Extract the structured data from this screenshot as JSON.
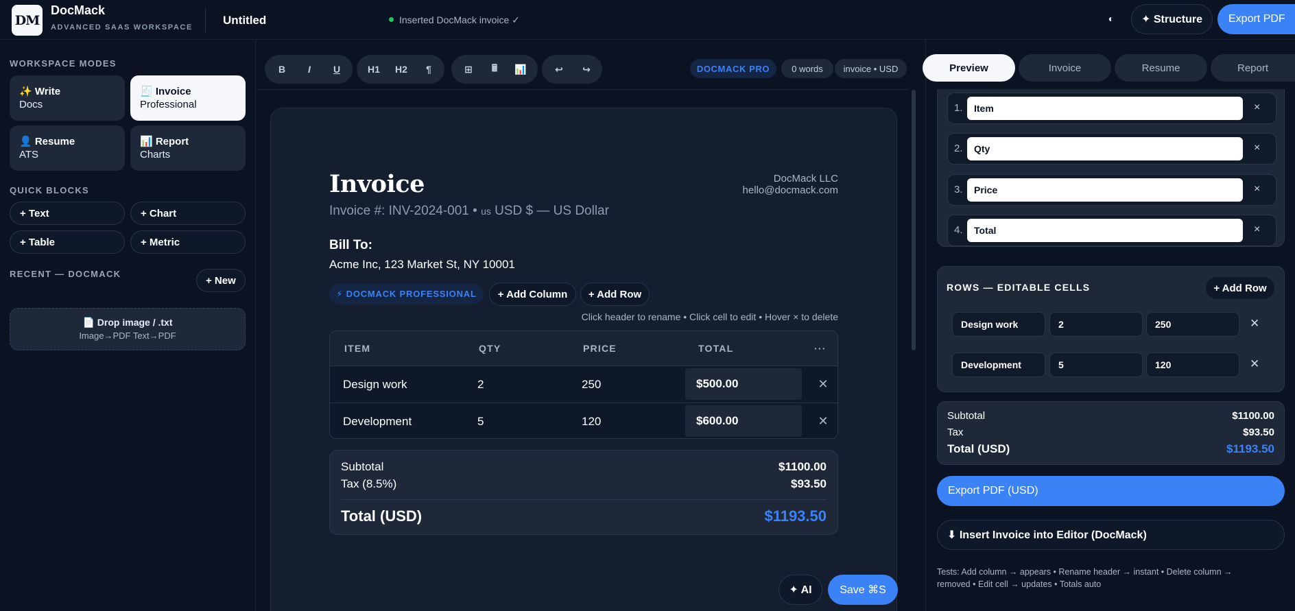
{
  "header": {
    "logo": "DM",
    "app_name": "DocMack",
    "app_subtitle": "ADVANCED SAAS WORKSPACE",
    "doc_title": "Untitled",
    "status": "Inserted DocMack invoice ✓",
    "theme_icon": "◐",
    "structure_label": "✦ Structure",
    "export_label": "Export PDF"
  },
  "sidebar": {
    "modes_label": "WORKSPACE MODES",
    "modes": [
      {
        "title": "✨ Write",
        "sub": "Docs",
        "active": false
      },
      {
        "title": "🧾 Invoice",
        "sub": "Professional",
        "active": true
      },
      {
        "title": "👤 Resume",
        "sub": "ATS",
        "active": false
      },
      {
        "title": "📊 Report",
        "sub": "Charts",
        "active": false
      }
    ],
    "blocks_label": "QUICK BLOCKS",
    "blocks": [
      "+ Text",
      "+ Chart",
      "+ Table",
      "+ Metric"
    ],
    "recent_label": "RECENT — DOCMACK",
    "new_label": "+ New",
    "drop_title": "📄 Drop image / .txt",
    "drop_sub": "Image→PDF Text→PDF"
  },
  "toolbar": {
    "format": [
      "B",
      "I",
      "U"
    ],
    "headings": [
      "H1",
      "H2",
      "¶"
    ],
    "inserts": [
      "⊞",
      "🖩",
      "📊"
    ],
    "history": [
      "↩",
      "↪"
    ],
    "pro_badge": "DOCMACK PRO",
    "word_count": "0 words",
    "doc_type": "invoice • USD"
  },
  "invoice": {
    "title": "Invoice",
    "number_prefix": "Invoice #: INV-2024-001 • ",
    "number_us": "us",
    "number_suffix": " USD $ — US Dollar",
    "company": "DocMack LLC",
    "email": "hello@docmack.com",
    "bill_to_label": "Bill To:",
    "bill_to_address": "Acme Inc, 123 Market St, NY 10001",
    "pro_badge": "⚡ DOCMACK PROFESSIONAL",
    "add_column": "+ Add Column",
    "add_row": "+ Add Row",
    "hint": "Click header to rename • Click cell to edit • Hover × to delete",
    "columns": [
      "ITEM",
      "QTY",
      "PRICE",
      "TOTAL",
      "···"
    ],
    "rows": [
      {
        "item": "Design work",
        "qty": "2",
        "price": "250",
        "total": "$500.00",
        "delete": "✕"
      },
      {
        "item": "Development",
        "qty": "5",
        "price": "120",
        "total": "$600.00",
        "delete": "✕"
      }
    ],
    "subtotal_label": "Subtotal",
    "subtotal": "$1100.00",
    "tax_label": "Tax (8.5%)",
    "tax": "$93.50",
    "total_label": "Total (USD)",
    "total": "$1193.50"
  },
  "editor_actions": {
    "ai": "✦ AI",
    "save": "Save ⌘S"
  },
  "right_panel": {
    "tabs": [
      "Preview",
      "Invoice",
      "Resume",
      "Report"
    ],
    "columns": [
      {
        "num": "1.",
        "name": "Item"
      },
      {
        "num": "2.",
        "name": "Qty"
      },
      {
        "num": "3.",
        "name": "Price"
      },
      {
        "num": "4.",
        "name": "Total"
      }
    ],
    "col_delete": "×",
    "rows_label": "ROWS — EDITABLE CELLS",
    "add_row": "+ Add Row",
    "rows": [
      {
        "item": "Design work",
        "qty": "2",
        "price": "250",
        "delete": "✕"
      },
      {
        "item": "Development",
        "qty": "5",
        "price": "120",
        "delete": "✕"
      }
    ],
    "subtotal_label": "Subtotal",
    "subtotal": "$1100.00",
    "tax_label": "Tax",
    "tax": "$93.50",
    "total_label": "Total (USD)",
    "total": "$1193.50",
    "export_label": "Export PDF (USD)",
    "insert_label": "⬇ Insert Invoice into Editor (DocMack)",
    "tests_note": "Tests: Add column → appears • Rename header → instant • Delete column → removed • Edit cell → updates • Totals auto"
  },
  "colors": {
    "background": "#0b1322",
    "accent": "#3b82f6",
    "status_ok": "#22c55e"
  }
}
